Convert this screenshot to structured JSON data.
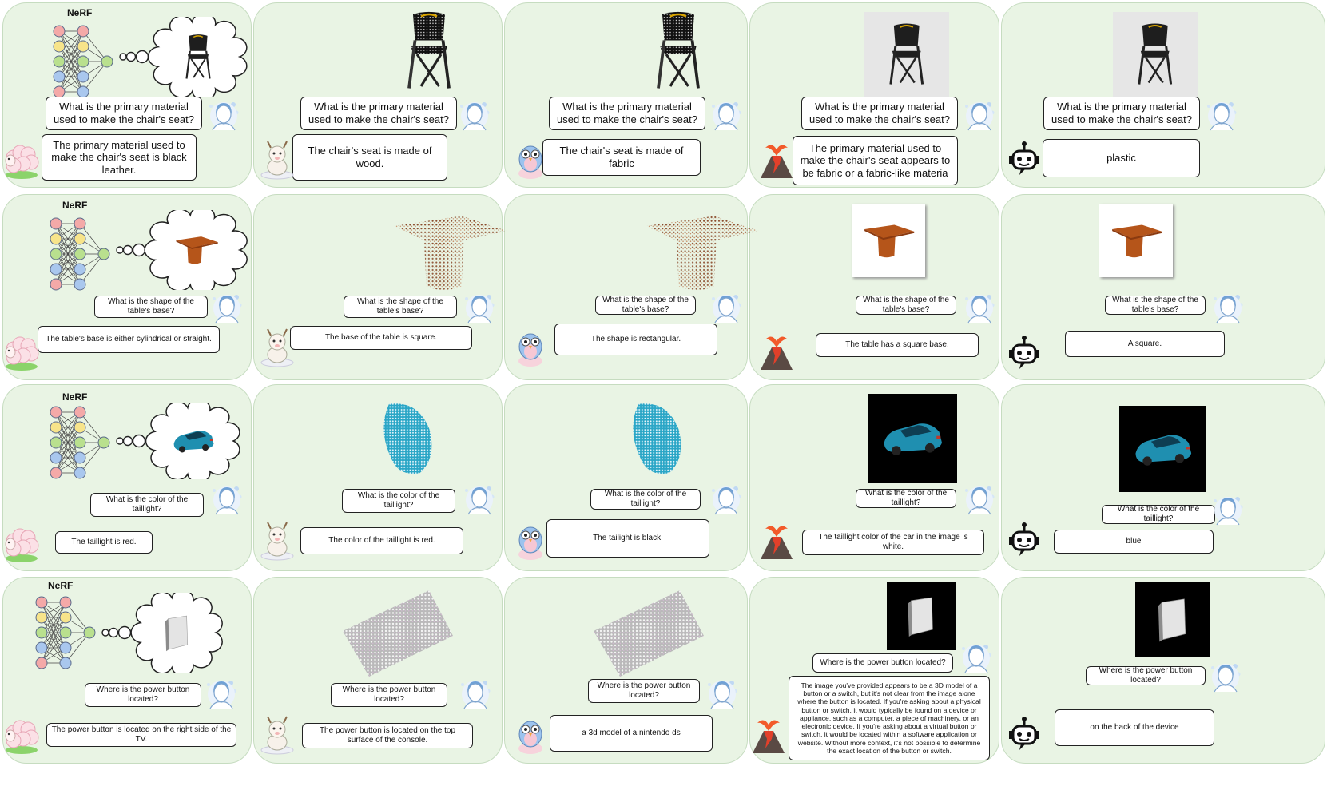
{
  "nerf_label": "NeRF",
  "columns": [
    "sheep",
    "goat",
    "owl",
    "volcano",
    "robot"
  ],
  "rows": [
    {
      "object": "chair",
      "question": "What is the primary material used to make the chair's seat?",
      "answers": [
        "The primary material used to make the chair's seat is black leather.",
        "The chair's seat is made of wood.",
        "The chair's seat is made of fabric",
        "The primary material used to make the chair's seat appears to be fabric or a fabric-like materia",
        "plastic"
      ]
    },
    {
      "object": "table",
      "question": "What is the shape of the table's base?",
      "answers": [
        "The table's base is either cylindrical or straight.",
        "The base of the table is square.",
        "The shape is rectangular.",
        "The table has a square base.",
        "A square."
      ]
    },
    {
      "object": "car",
      "question": "What is the color of the taillight?",
      "answers": [
        "The taillight is red.",
        "The color of the taillight is red.",
        "The tailight is black.",
        "The taillight color of the car in the image is white.",
        "blue"
      ]
    },
    {
      "object": "console",
      "question": "Where is the power button located?",
      "answers": [
        "The power button is located on the right side of the TV.",
        "The power button is located on the top surface of the console.",
        "a 3d model of a nintendo ds",
        "The image you've provided appears to be a 3D model of a button or a switch, but it's not clear from the image alone where the button is located. If you're asking about a physical button or switch, it would typically be found on a device or appliance, such as a computer, a piece of machinery, or an electronic device. If you're asking about a virtual button or switch, it would be located within a software application or website. Without more context, it's not possible to determine the exact location of the button or switch.",
        "on the back of the device"
      ]
    }
  ],
  "colors": {
    "panel_bg": "#e9f4e4",
    "panel_border": "#c6dcc0",
    "node_red": "#f4a9a8",
    "node_yellow": "#f7e48a",
    "node_green": "#b9e08e",
    "node_blue": "#a9c7ee",
    "chair": "#1e1e1e",
    "table": "#b5551a",
    "car": "#1f8fb0",
    "console": "#c9c9c9"
  }
}
